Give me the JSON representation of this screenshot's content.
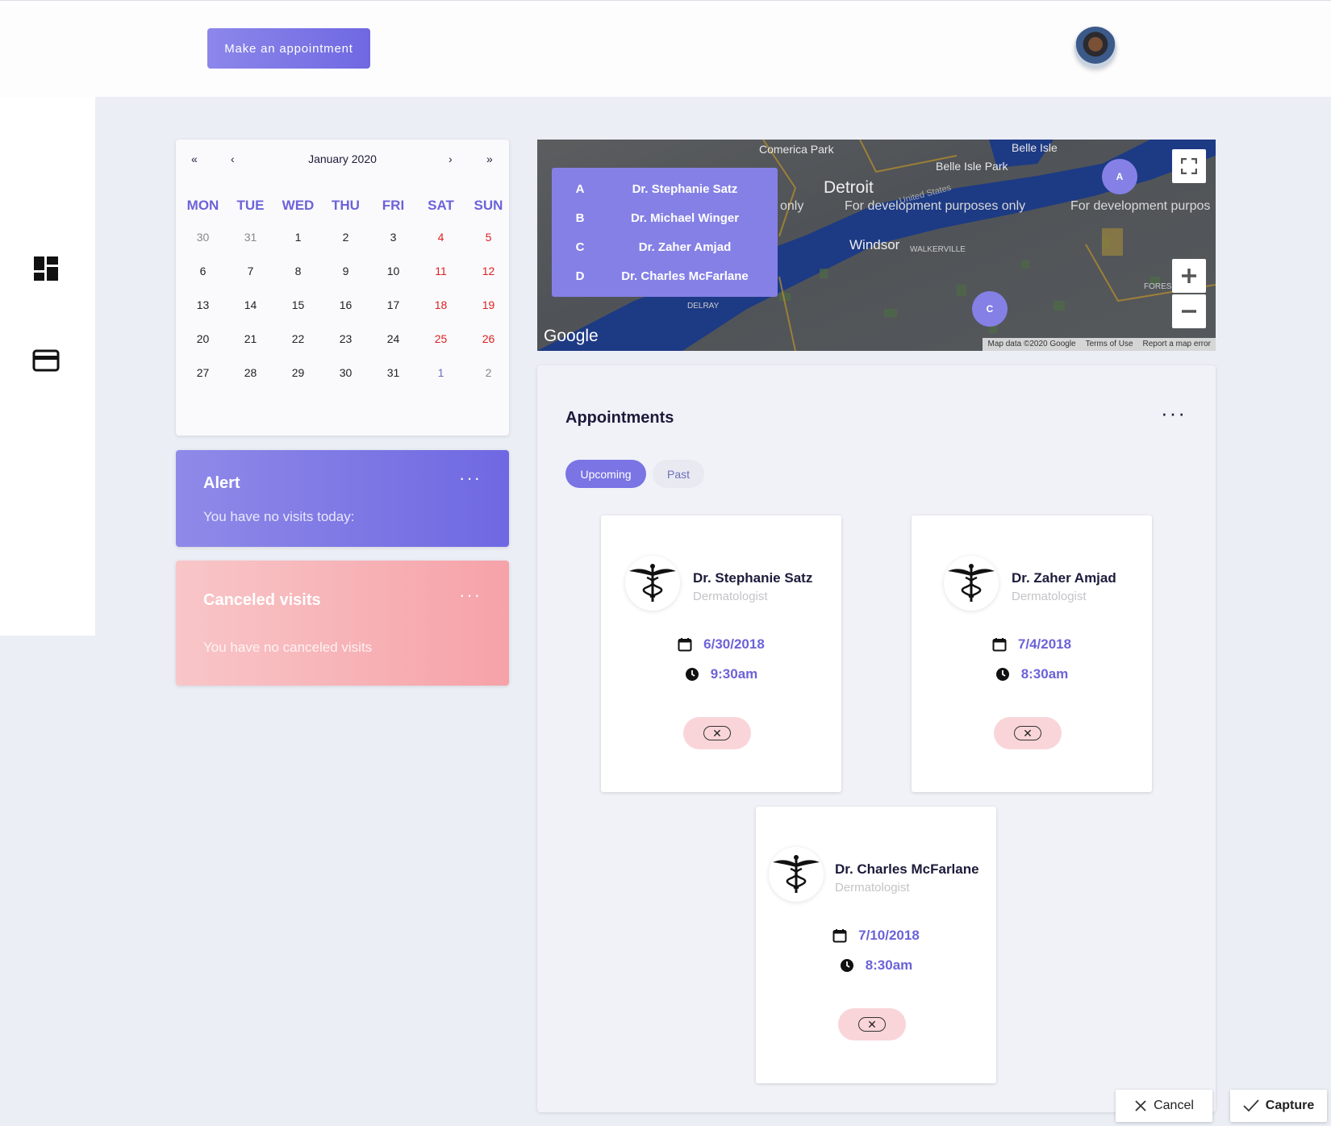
{
  "topbar": {
    "appointment_button": "Make an appointment"
  },
  "sidebar": {
    "items": [
      {
        "icon": "dashboard-icon"
      },
      {
        "icon": "credit-card-icon"
      }
    ]
  },
  "calendar": {
    "first_label": "«",
    "prev_label": "‹",
    "title": "January 2020",
    "next_label": "›",
    "last_label": "»",
    "weekdays": [
      "MON",
      "TUE",
      "WED",
      "THU",
      "FRI",
      "SAT",
      "SUN"
    ],
    "weeks": [
      [
        "30",
        "31",
        "1",
        "2",
        "3",
        "4",
        "5"
      ],
      [
        "6",
        "7",
        "8",
        "9",
        "10",
        "11",
        "12"
      ],
      [
        "13",
        "14",
        "15",
        "16",
        "17",
        "18",
        "19"
      ],
      [
        "20",
        "21",
        "22",
        "23",
        "24",
        "25",
        "26"
      ],
      [
        "27",
        "28",
        "29",
        "30",
        "31",
        "1",
        "2"
      ]
    ]
  },
  "alert": {
    "title": "Alert",
    "text": "You have no visits today:",
    "menu": "···"
  },
  "canceled": {
    "title": "Canceled visits",
    "text": "You have no canceled visits",
    "menu": "···"
  },
  "map": {
    "legend": [
      {
        "letter": "A",
        "name": "Dr. Stephanie Satz"
      },
      {
        "letter": "B",
        "name": "Dr. Michael Winger"
      },
      {
        "letter": "C",
        "name": "Dr. Zaher Amjad"
      },
      {
        "letter": "D",
        "name": "Dr. Charles McFarlane"
      }
    ],
    "markers": [
      "A",
      "C"
    ],
    "labels": {
      "comerica": "Comerica Park",
      "belle_isle": "Belle Isle",
      "belle_isle_park": "Belle Isle Park",
      "detroit": "Detroit",
      "united_states": "United States",
      "dev1": "For development purposes only",
      "dev2": "For development purpos",
      "dev_left": "only",
      "windsor": "Windsor",
      "walkerville": "WALKERVILLE",
      "delray": "DELRAY",
      "fores": "FORES"
    },
    "google": "Google",
    "footer": [
      "Map data ©2020 Google",
      "Terms of Use",
      "Report a map error"
    ]
  },
  "appointments": {
    "title": "Appointments",
    "menu": "···",
    "tabs": {
      "upcoming": "Upcoming",
      "past": "Past"
    },
    "cards": [
      {
        "doctor": "Dr. Stephanie Satz",
        "specialty": "Dermatologist",
        "date": "6/30/2018",
        "time": "9:30am"
      },
      {
        "doctor": "Dr. Zaher Amjad",
        "specialty": "Dermatologist",
        "date": "7/4/2018",
        "time": "8:30am"
      },
      {
        "doctor": "Dr. Charles McFarlane",
        "specialty": "Dermatologist",
        "date": "7/10/2018",
        "time": "8:30am"
      }
    ]
  },
  "capture_bar": {
    "cancel": "Cancel",
    "capture": "Capture"
  },
  "colors": {
    "accent": "#7a74e4",
    "weekend": "#e02020",
    "alert_bg": "#7f79e6",
    "canceled_bg": "#f6a8ae"
  }
}
